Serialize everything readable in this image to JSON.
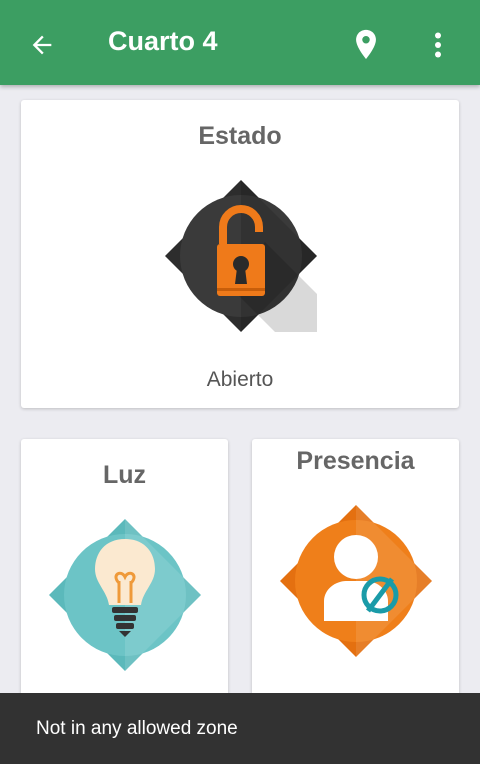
{
  "appbar": {
    "title": "Cuarto 4",
    "back_icon": "arrow-back-icon",
    "location_icon": "location-pin-icon",
    "menu_icon": "more-vert-icon",
    "color": "#3c9e62"
  },
  "cards": {
    "estado": {
      "title": "Estado",
      "status": "Abierto",
      "icon": "unlocked-padlock-icon",
      "badge_color": "#3a3a3a",
      "icon_color": "#ef7a1a"
    },
    "luz": {
      "title": "Luz",
      "icon": "light-bulb-icon",
      "badge_color": "#6cc4c6"
    },
    "presencia": {
      "title": "Presencia",
      "icon": "person-absent-icon",
      "badge_color": "#ef7f1a",
      "accent_color": "#1a9ba8"
    }
  },
  "snackbar": {
    "message": "Not in any allowed zone"
  }
}
